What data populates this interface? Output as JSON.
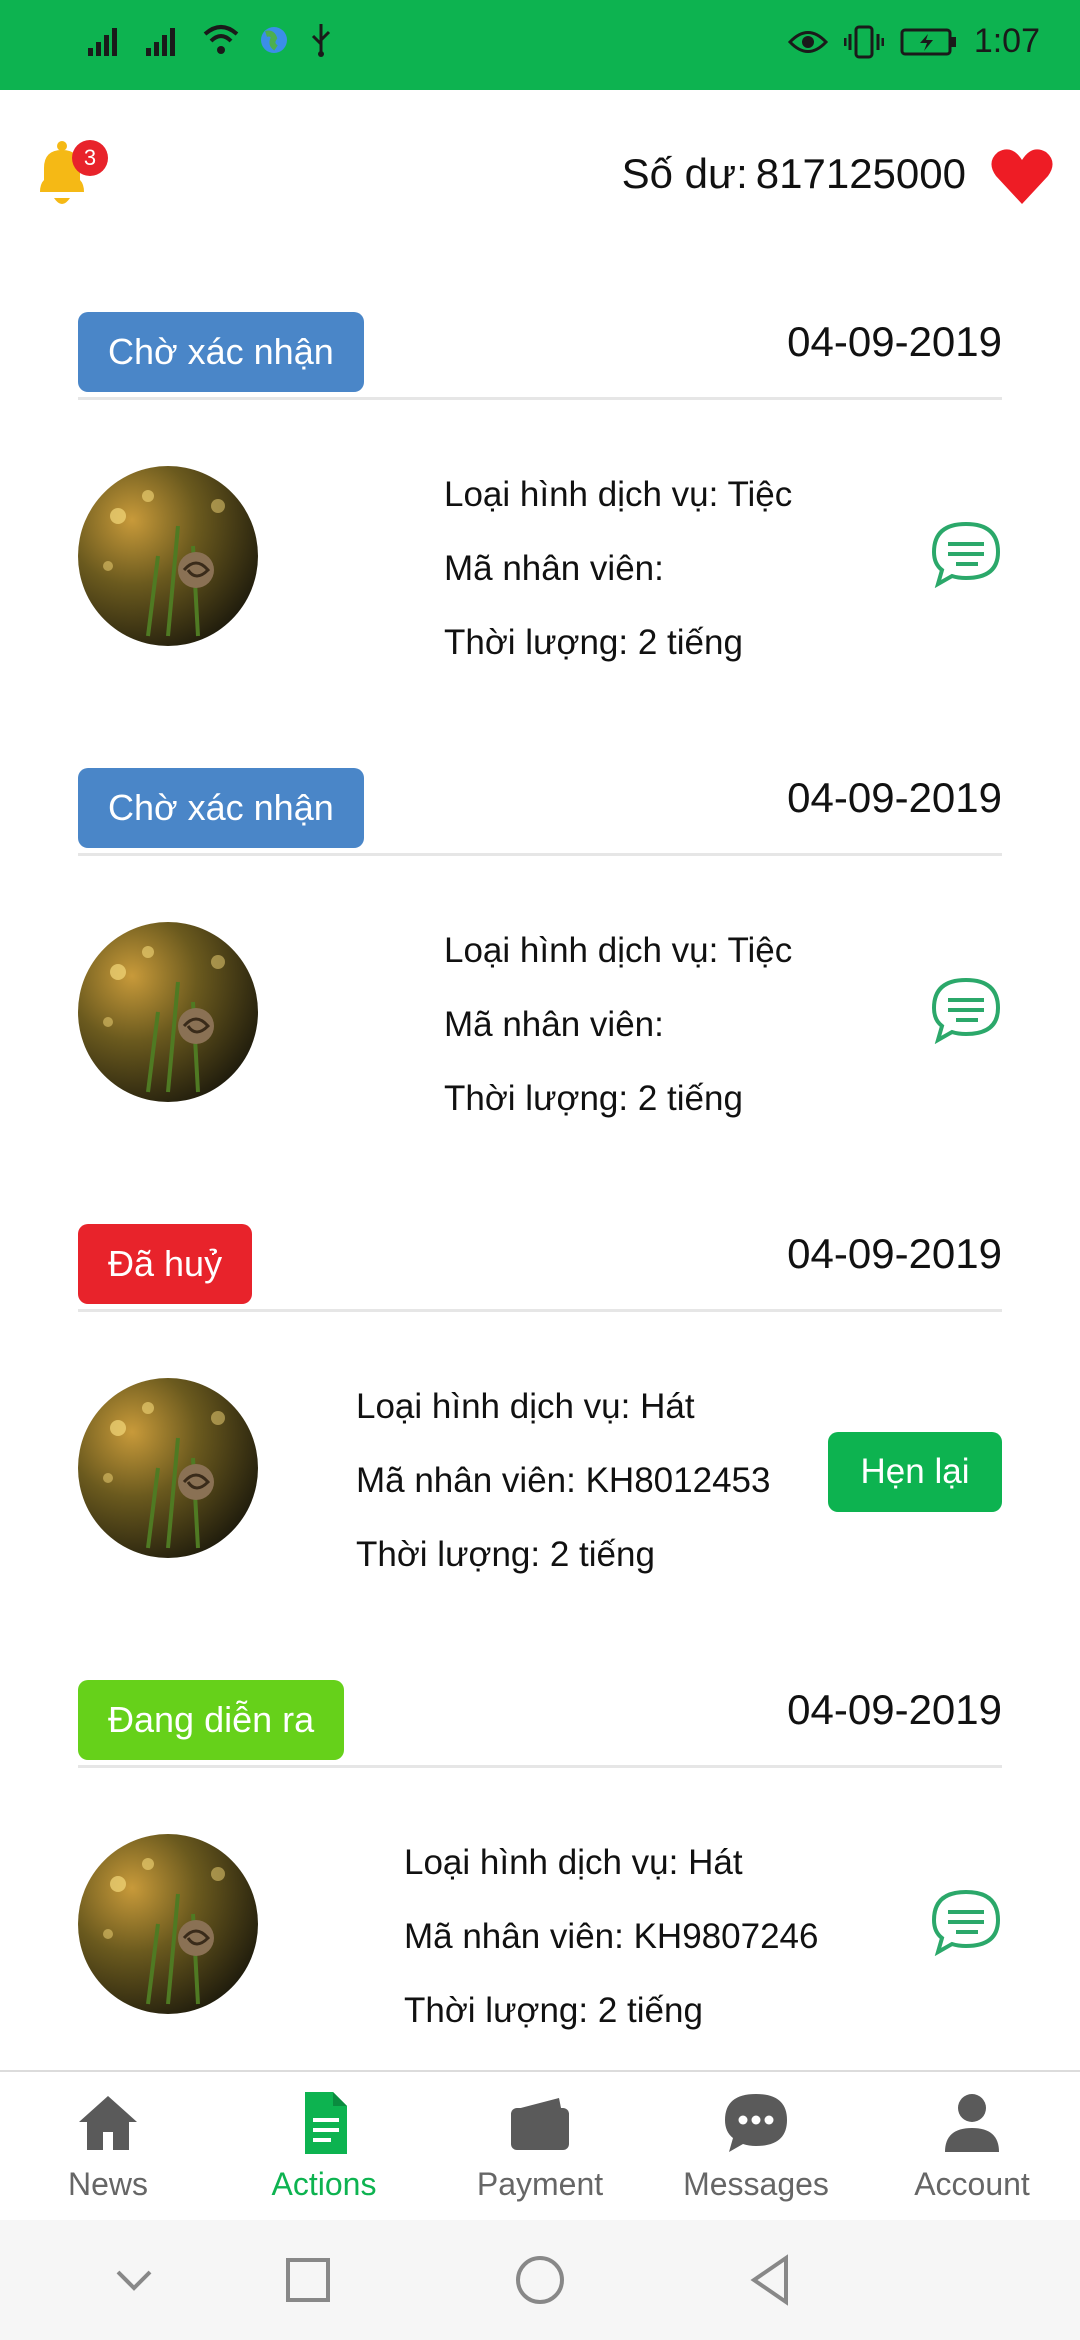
{
  "status_bar": {
    "time": "1:07"
  },
  "header": {
    "notification_count": "3",
    "balance_label": "Số dư:",
    "balance_value": "817125000"
  },
  "orders": [
    {
      "status": "Chờ xác nhận",
      "status_color": "#4a86c8",
      "date": "04-09-2019",
      "service_label": "Loại hình dịch vụ: Tiệc",
      "employee_label": "Mã nhân viên:",
      "duration_label": "Thời lượng: 2 tiếng",
      "action": "chat-icon"
    },
    {
      "status": "Chờ xác nhận",
      "status_color": "#4a86c8",
      "date": "04-09-2019",
      "service_label": "Loại hình dịch vụ: Tiệc",
      "employee_label": "Mã nhân viên:",
      "duration_label": "Thời lượng: 2 tiếng",
      "action": "chat-icon"
    },
    {
      "status": "Đã huỷ",
      "status_color": "#e8232b",
      "date": "04-09-2019",
      "service_label": "Loại hình dịch vụ: Hát",
      "employee_label": "Mã nhân viên: KH8012453",
      "duration_label": "Thời lượng: 2 tiếng",
      "action_label": "Hẹn lại"
    },
    {
      "status": "Đang diễn ra",
      "status_color": "#66d11a",
      "date": "04-09-2019",
      "service_label": "Loại hình dịch vụ: Hát",
      "employee_label": "Mã nhân viên: KH9807246",
      "duration_label": "Thời lượng: 2 tiếng",
      "action": "chat-icon"
    }
  ],
  "tabs": [
    {
      "label": "News",
      "icon": "home-icon"
    },
    {
      "label": "Actions",
      "icon": "document-icon",
      "active": true
    },
    {
      "label": "Payment",
      "icon": "wallet-icon"
    },
    {
      "label": "Messages",
      "icon": "chat-bubble-icon"
    },
    {
      "label": "Account",
      "icon": "person-icon"
    }
  ],
  "colors": {
    "primary": "#0db350",
    "chat": "#2ba86a"
  }
}
